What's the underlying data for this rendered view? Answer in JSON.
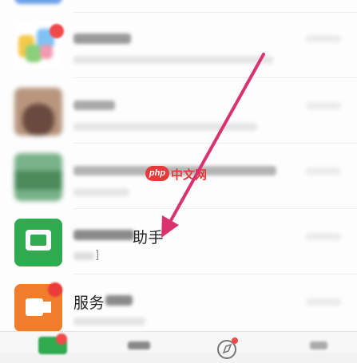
{
  "chat_list": {
    "items": [
      {
        "name": "",
        "preview": "",
        "time": ""
      },
      {
        "name": "",
        "preview": "",
        "time": ""
      },
      {
        "name": "",
        "preview": "",
        "time": ""
      },
      {
        "name": "",
        "preview": "",
        "time": ""
      },
      {
        "name": "助手",
        "preview": "]",
        "time": ""
      },
      {
        "name": "服务",
        "preview": "",
        "time": ""
      }
    ]
  },
  "watermark": {
    "logo_text": "php",
    "site_text": "中文网"
  },
  "annotation": {
    "arrow_color": "#d9326e"
  },
  "tabbar": {
    "tabs": [
      "",
      "",
      "",
      ""
    ]
  }
}
